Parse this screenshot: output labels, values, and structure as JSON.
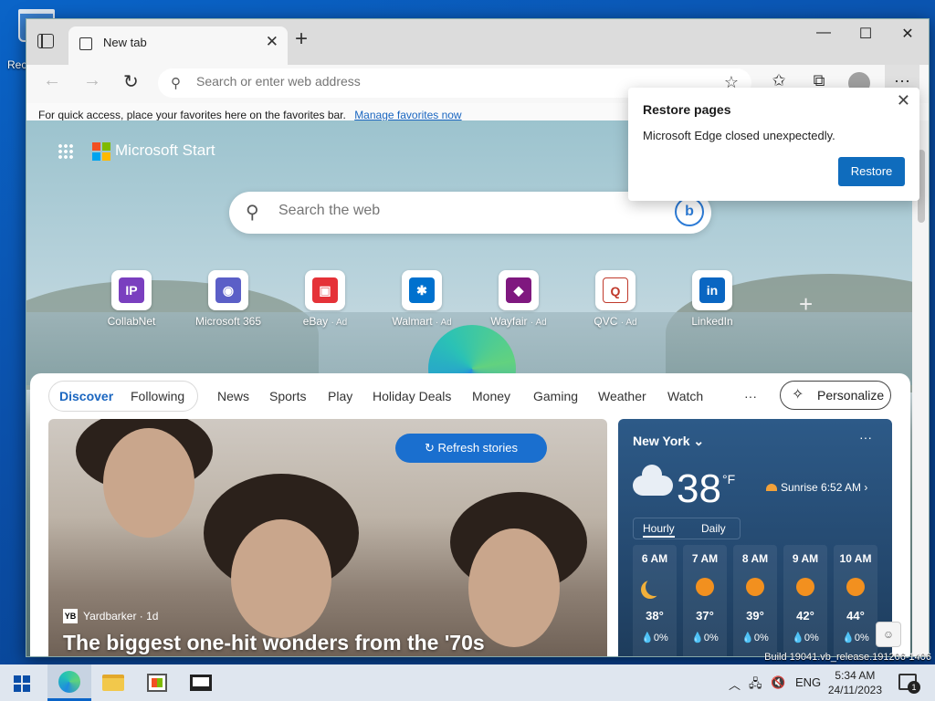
{
  "desktop": {
    "recycle_bin_label": "Rec",
    "build_info": "Build 19041.vb_release.191206-1406"
  },
  "browser": {
    "tab_title": "New tab",
    "window_controls": {
      "minimize": "—",
      "maximize": "☐",
      "close": "✕"
    },
    "address_placeholder": "Search or enter web address",
    "favbar": {
      "text": "For quick access, place your favorites here on the favorites bar.",
      "link": "Manage favorites now"
    }
  },
  "restore_popup": {
    "title": "Restore pages",
    "message": "Microsoft Edge closed unexpectedly.",
    "button": "Restore"
  },
  "start_page": {
    "brand": "Microsoft Start",
    "search_placeholder": "Search the web",
    "quick_links": [
      {
        "label": "CollabNet",
        "ad": "",
        "glyph": "IP",
        "color": "#7a3fbf"
      },
      {
        "label": "Microsoft 365",
        "ad": "",
        "glyph": "◉",
        "color": "#5b5fc7"
      },
      {
        "label": "eBay",
        "ad": "· Ad",
        "glyph": "▣",
        "color": "#e53238"
      },
      {
        "label": "Walmart",
        "ad": "· Ad",
        "glyph": "✱",
        "color": "#0071ce"
      },
      {
        "label": "Wayfair",
        "ad": "· Ad",
        "glyph": "◆",
        "color": "#7f187f"
      },
      {
        "label": "QVC",
        "ad": "· Ad",
        "glyph": "Q",
        "color": "#d2d2d2"
      },
      {
        "label": "LinkedIn",
        "ad": "",
        "glyph": "in",
        "color": "#0a66c2"
      }
    ],
    "categories": {
      "discover": "Discover",
      "following": "Following",
      "items": [
        "News",
        "Sports",
        "Play",
        "Holiday Deals",
        "Money",
        "Gaming",
        "Weather",
        "Watch"
      ],
      "more": "···"
    },
    "personalize": "Personalize",
    "refresh": "Refresh stories",
    "hero": {
      "source": "Yardbarker · 1d",
      "source_logo": "YB",
      "headline": "The biggest one-hit wonders from the '70s"
    },
    "weather": {
      "city": "New York",
      "temp": "38",
      "unit": "°F",
      "sunrise": "Sunrise 6:52 AM",
      "tabs": [
        "Hourly",
        "Daily"
      ],
      "hours": [
        {
          "time": "6 AM",
          "temp": "38°",
          "precip": "💧0%",
          "icon": "moon-icon"
        },
        {
          "time": "7 AM",
          "temp": "37°",
          "precip": "💧0%",
          "icon": "sun-icon"
        },
        {
          "time": "8 AM",
          "temp": "39°",
          "precip": "💧0%",
          "icon": "sun-icon"
        },
        {
          "time": "9 AM",
          "temp": "42°",
          "precip": "💧0%",
          "icon": "sun-icon"
        },
        {
          "time": "10 AM",
          "temp": "44°",
          "precip": "💧0%",
          "icon": "sun-icon"
        }
      ]
    }
  },
  "taskbar": {
    "language": "ENG",
    "time": "5:34 AM",
    "date": "24/11/2023",
    "notification_count": "1"
  }
}
